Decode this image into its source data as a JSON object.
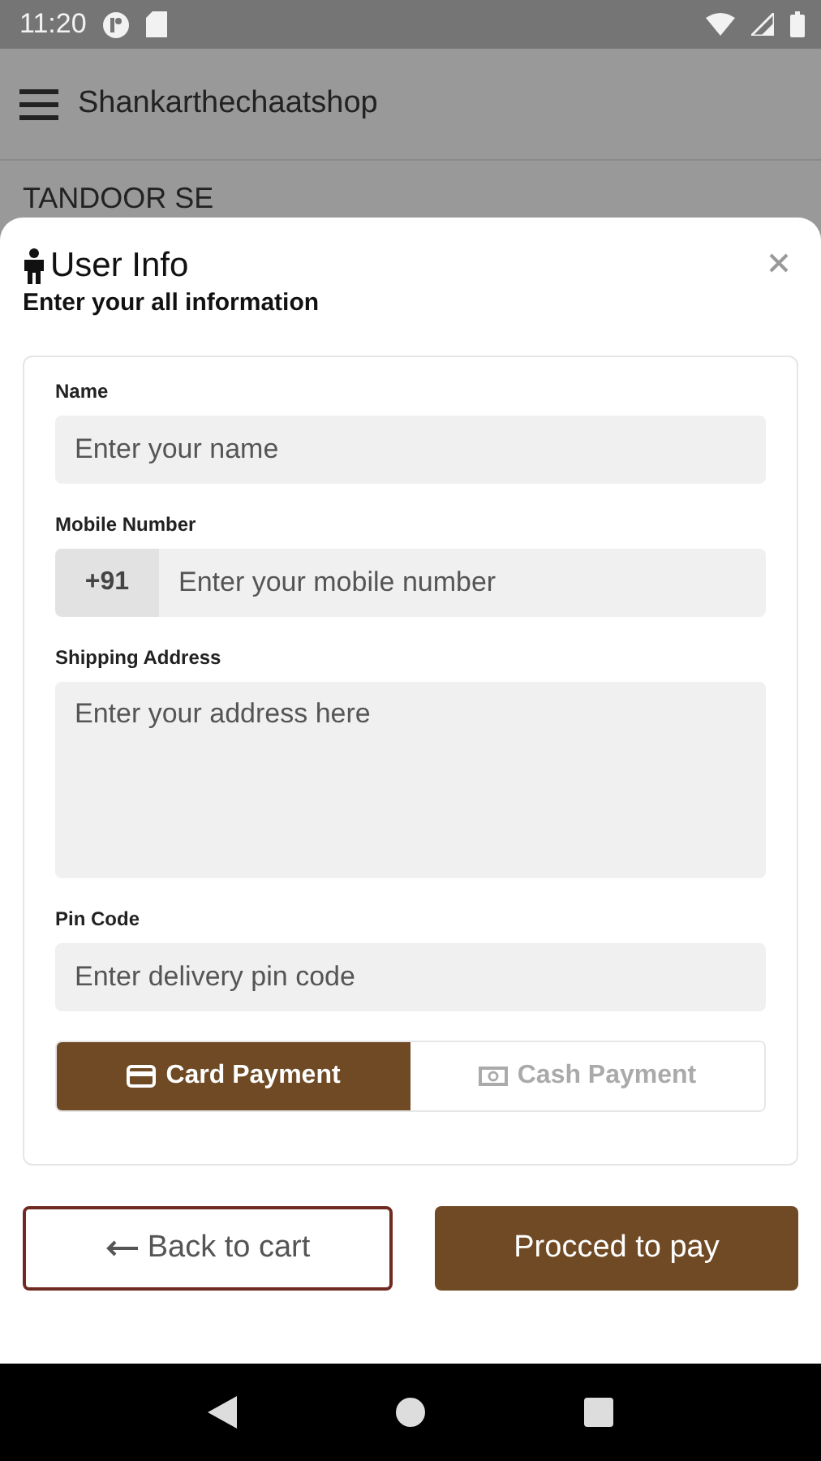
{
  "status_bar": {
    "time": "11:20"
  },
  "app_bar": {
    "title": "Shankarthechaatshop"
  },
  "background": {
    "heading": "TANDOOR SE"
  },
  "sheet": {
    "title": "User Info",
    "subtitle": "Enter your all information",
    "fields": [
      {
        "kind": "text",
        "label": "Name",
        "placeholder": "Enter your name"
      },
      {
        "kind": "phone",
        "label": "Mobile Number",
        "prefix": "+91",
        "placeholder": "Enter your mobile number"
      },
      {
        "kind": "textarea",
        "label": "Shipping Address",
        "placeholder": "Enter your address here"
      },
      {
        "kind": "text",
        "label": "Pin Code",
        "placeholder": "Enter delivery pin code"
      }
    ],
    "payment_options": [
      {
        "kind": "card",
        "label": "Card Payment",
        "selected": true
      },
      {
        "kind": "cash",
        "label": "Cash Payment",
        "selected": false
      }
    ],
    "buttons": [
      {
        "kind": "back",
        "label": "Back to cart"
      },
      {
        "kind": "primary",
        "label": "Procced to pay"
      }
    ]
  }
}
